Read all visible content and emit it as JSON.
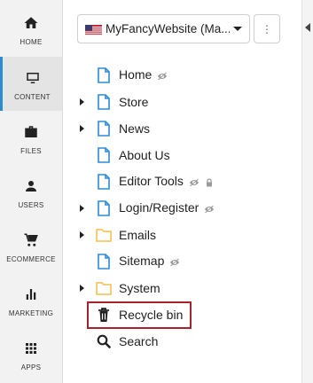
{
  "nav": {
    "items": [
      {
        "label": "HOME",
        "icon": "home-icon"
      },
      {
        "label": "CONTENT",
        "icon": "monitor-icon",
        "active": true
      },
      {
        "label": "FILES",
        "icon": "briefcase-icon"
      },
      {
        "label": "USERS",
        "icon": "user-icon"
      },
      {
        "label": "ECOMMERCE",
        "icon": "cart-icon"
      },
      {
        "label": "MARKETING",
        "icon": "bar-chart-icon"
      },
      {
        "label": "APPS",
        "icon": "grid-icon"
      }
    ]
  },
  "site_selector": {
    "value": "MyFancyWebsite (Ma...",
    "flag": "us-flag-icon"
  },
  "more_button": {
    "label": "⋮"
  },
  "tree": {
    "items": [
      {
        "label": "Home",
        "type": "page",
        "expandable": false,
        "hidden": true,
        "locked": false
      },
      {
        "label": "Store",
        "type": "page",
        "expandable": true,
        "hidden": false,
        "locked": false
      },
      {
        "label": "News",
        "type": "page",
        "expandable": true,
        "hidden": false,
        "locked": false
      },
      {
        "label": "About Us",
        "type": "page",
        "expandable": false,
        "hidden": false,
        "locked": false
      },
      {
        "label": "Editor Tools",
        "type": "page",
        "expandable": false,
        "hidden": true,
        "locked": true
      },
      {
        "label": "Login/Register",
        "type": "page",
        "expandable": true,
        "hidden": true,
        "locked": false
      },
      {
        "label": "Emails",
        "type": "folder",
        "expandable": true,
        "hidden": false,
        "locked": false
      },
      {
        "label": "Sitemap",
        "type": "page",
        "expandable": false,
        "hidden": true,
        "locked": false
      },
      {
        "label": "System",
        "type": "folder",
        "expandable": true,
        "hidden": false,
        "locked": false
      },
      {
        "label": "Recycle bin",
        "type": "trash",
        "expandable": false,
        "hidden": false,
        "locked": false,
        "highlighted": true
      },
      {
        "label": "Search",
        "type": "search",
        "expandable": false,
        "hidden": false,
        "locked": false
      }
    ]
  },
  "colors": {
    "page_icon": "#2b8cd6",
    "folder_icon": "#f2c14e",
    "highlight": "#a8222c",
    "active_rail": "#2b8cd6"
  }
}
